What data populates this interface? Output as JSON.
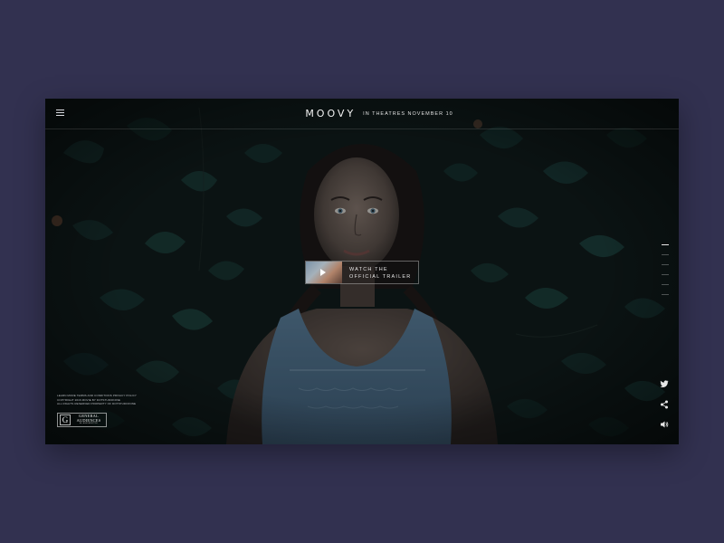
{
  "header": {
    "logo": "MOOVY",
    "release": "IN THEATRES NOVEMBER 10",
    "menu_icon": "hamburger-menu-icon"
  },
  "trailer": {
    "line1": "WATCH THE",
    "line2": "OFFICIAL TRAILER",
    "icon": "play-icon"
  },
  "pager": {
    "count": 6,
    "active_index": 0
  },
  "legal": {
    "line1": "LEARN MORE TERMS AND CONDITIONS PRIVACY POLICY",
    "line2": "COPYRIGHT 2016 MOVIE BY DOTSTUDIONINE",
    "line3": "ALL RIGHTS RESERVED PROPERTY OF DOTSTUDIONINE"
  },
  "rating": {
    "letter": "G",
    "line1": "GENERAL",
    "line2": "AUDIENCES",
    "sub": "ALL AGES ADMITTED"
  },
  "social": {
    "twitter_icon": "twitter-icon",
    "share_icon": "share-icon",
    "sound_icon": "speaker-icon"
  },
  "colors": {
    "page_background": "#323150",
    "text": "#f2f2f2",
    "foliage": "#12302e",
    "dress": "#55799a"
  }
}
